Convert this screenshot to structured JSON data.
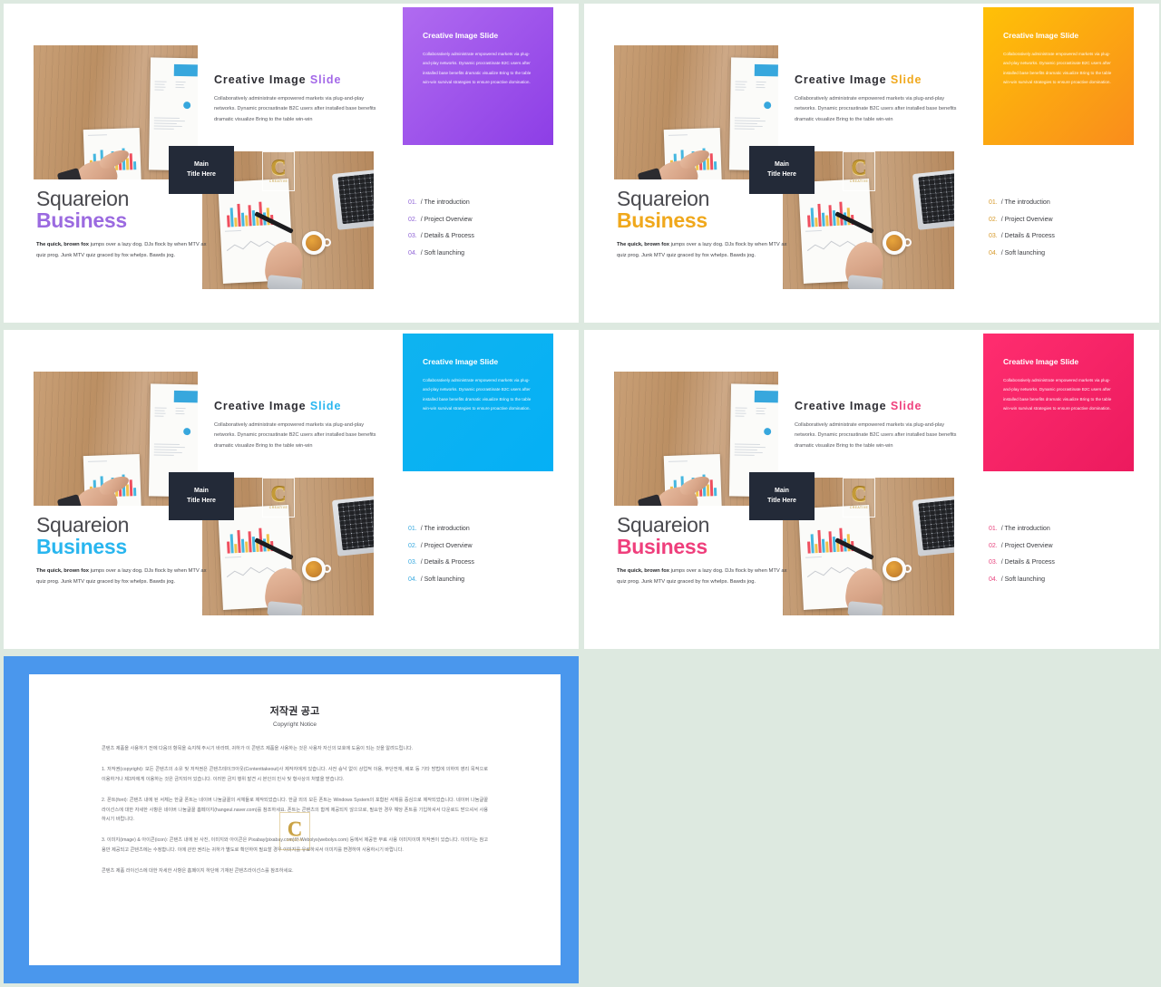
{
  "page": {
    "background_color": "#dde9e0",
    "gutter_color": "#e4efe7"
  },
  "common": {
    "headline_main": "Creative Image",
    "headline_accent": "Slide",
    "headline_body": "Collaboratively administrate empowered  markets via plug-and-play networks. Dynamic procrastinate B2C users after  installed base benefits dramatic visualize Bring to the  table win-win",
    "brand_line1": "Squareion",
    "brand_line2": "Business",
    "brand_body_bold": "The quick, brown fox",
    "brand_body_rest": " jumps over  a lazy dog. DJs flock by when MTV ax quiz prog. Junk MTV quiz graced by fox whelps. Bawds jog.",
    "title_box_line1": "Main",
    "title_box_line2": "Title Here",
    "card_title": "Creative Image Slide",
    "card_body": "Collaboratively administrate empowered markets via plug-and-play networks. Dynamic procrastinate B2C users after  installed base benefits dramatic visualize Bring to the  table win-win survival strategies to ensure proactive domination.",
    "agenda": [
      {
        "num": "01.",
        "sep": "/",
        "label": "The introduction"
      },
      {
        "num": "02.",
        "sep": "/",
        "label": "Project Overview"
      },
      {
        "num": "03.",
        "sep": "/",
        "label": "Details & Process"
      },
      {
        "num": "04.",
        "sep": "/",
        "label": "Soft launching"
      }
    ],
    "watermark_letter": "C",
    "watermark_caption": "CREATIVE"
  },
  "slides": [
    {
      "id": "slide-purple",
      "accent": "#a368e8",
      "brand_color": "#9b6ae0",
      "agenda_num_color": "#8f63d6",
      "card_gradient_from": "#b06bf0",
      "card_gradient_to": "#8d3ee6"
    },
    {
      "id": "slide-amber",
      "accent": "#f0a81c",
      "brand_color": "#f0a81c",
      "agenda_num_color": "#d79a2a",
      "card_gradient_from": "#ffc107",
      "card_gradient_to": "#f98c1c"
    },
    {
      "id": "slide-cyan",
      "accent": "#29b6ef",
      "brand_color": "#29b6ef",
      "agenda_num_color": "#37a9e0",
      "card_gradient_from": "#0fb3f0",
      "card_gradient_to": "#05b0f5"
    },
    {
      "id": "slide-pink",
      "accent": "#ef3f7c",
      "brand_color": "#ef3f7c",
      "agenda_num_color": "#e8467f",
      "card_gradient_from": "#ff2d6f",
      "card_gradient_to": "#ec1a5e"
    }
  ],
  "copyright_slide": {
    "border_color": "#4a97ed",
    "title_ko": "저작권 공고",
    "title_en": "Copyright Notice",
    "intro": "콘텐츠 제품을 사용하기 전에 다음의 항목을 숙지해 주시기 바라며, 귀하가 이 콘텐츠 제품을 사용하는 것은 사용자 자신의 보호에 도움이 되는 것을 알려드립니다.",
    "section1": "1. 저작권(copyright): 모든 콘텐츠의 소유 및 저작권은 콘텐츠테이크아웃(Contenttakeout)사 제작자에게 있습니다. 사전 승낙 없이 상업적 이용, 무단전재, 배포 등 기타 방법에 의하여 영리 목적으로 이용하거나 제3자에게 이용하는 것은 금지되어 있습니다. 이러한 금지 행위 발견 시 본인의 민사 및 형사상의 처벌을 받습니다.",
    "section2": "2. 폰트(font): 콘텐츠 내에 된 서체는 한글 폰트는 네이버 나눔글꼴의 서체들로 제작되었습니다. 한글 외의 모든 폰트는 Windows System의 포함된 서체를 중심으로 제작되었습니다. 네이버 나눔글꼴 라이선스에 대한 자세한 사항은 네이버 나눔글꼴 홈페이지(hangeul.naver.com)를 참조하세요. 폰트는 콘텐츠의 함께 제공되지 않으므로, 필요한 경우 해당 폰트를 기입하셔서 다운로드 받으셔서 사용하시기 바랍니다.",
    "section3": "3. 이미지(image) & 아이콘(icon): 콘텐츠 내에 된 사진, 이미지와 아이콘은 Pixabay(pixabay.com)와 Webolys(webolys.com) 등에서 제공한 무료 사용 이미지이며 저작권이 있습니다. 이미지는 참고용만 제공되고 콘텐츠에는 수정합니다. 이에 관한 권리는 귀하가 별도로 확인하여 필요할 경우 이미지를 유료하셔서 이미지를 변경하여 사용하시기 바랍니다.",
    "footer": "콘텐츠 제품 라이선스에 대한 자세한 사항은 홈페이지 하단에 기재된 콘텐츠라이선스를 참조하세요."
  }
}
